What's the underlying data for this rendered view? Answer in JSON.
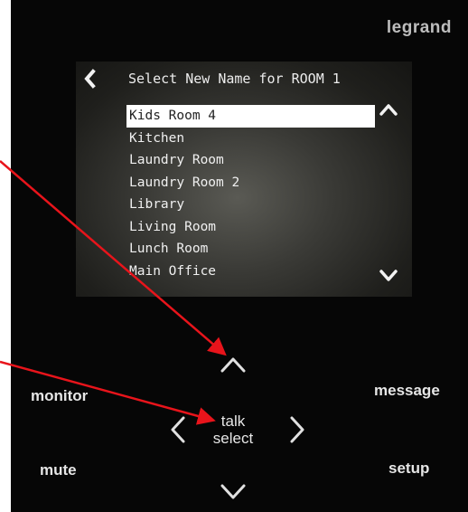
{
  "device": {
    "brand": "legrand",
    "screen": {
      "title": "Select New Name for ROOM 1",
      "items": [
        {
          "label": "Kids Room 4",
          "selected": true
        },
        {
          "label": "Kitchen"
        },
        {
          "label": "Laundry Room"
        },
        {
          "label": "Laundry Room 2"
        },
        {
          "label": "Library"
        },
        {
          "label": "Living Room"
        },
        {
          "label": "Lunch Room"
        },
        {
          "label": "Main Office"
        }
      ]
    },
    "buttons": {
      "monitor": "monitor",
      "message": "message",
      "mute": "mute",
      "setup": "setup",
      "talk": "talk",
      "select": "select"
    }
  },
  "icons": {
    "back": "chevron-left-icon",
    "scroll_up": "chevron-up-icon",
    "scroll_down": "chevron-down-icon",
    "nav_up": "chevron-up-icon",
    "nav_down": "chevron-down-icon",
    "nav_left": "chevron-left-icon",
    "nav_right": "chevron-right-icon"
  },
  "colors": {
    "panel": "#060606",
    "arrow": "#e8141b",
    "selected_row": "#ffffff"
  }
}
